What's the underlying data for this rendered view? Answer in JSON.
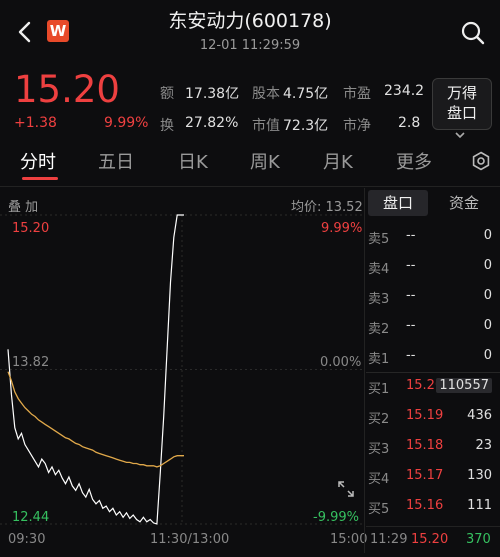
{
  "header": {
    "title": "东安动力(600178)",
    "time": "12-01 11:29:59",
    "logo_letter": "W",
    "back_icon": "chevron-left-icon",
    "search_icon": "search-icon"
  },
  "quote": {
    "price": "15.20",
    "change": "+1.38",
    "change_pct": "9.99%",
    "stats": [
      {
        "label": "额",
        "value": "17.38亿"
      },
      {
        "label": "股本",
        "value": "4.75亿"
      },
      {
        "label": "市盈",
        "value": "234.2"
      },
      {
        "label": "换",
        "value": "27.82%"
      },
      {
        "label": "市值",
        "value": "72.3亿"
      },
      {
        "label": "市净",
        "value": "2.8"
      }
    ],
    "wande_line1": "万得",
    "wande_line2": "盘口",
    "up_color": "#ee4040",
    "down_color": "#36c060"
  },
  "tabs": [
    {
      "label": "分时",
      "active": true
    },
    {
      "label": "五日",
      "active": false
    },
    {
      "label": "日K",
      "active": false
    },
    {
      "label": "周K",
      "active": false
    },
    {
      "label": "月K",
      "active": false
    },
    {
      "label": "更多",
      "active": false
    }
  ],
  "chart_labels": {
    "overlay": "叠 加",
    "avg_price": "均价: 13.52",
    "high": "15.20",
    "high_pct": "9.99%",
    "mid": "13.82",
    "mid_pct": "0.00%",
    "low": "12.44",
    "low_pct": "-9.99%",
    "t_start": "09:30",
    "t_mid": "11:30/13:00",
    "t_end": "15:00"
  },
  "chart_data": {
    "type": "line",
    "ylim": [
      12.44,
      15.2
    ],
    "series": [
      {
        "name": "price",
        "color": "#ffffff",
        "values": [
          14.0,
          13.6,
          13.3,
          13.2,
          13.25,
          13.15,
          13.1,
          13.05,
          13.0,
          12.95,
          13.02,
          12.98,
          12.9,
          12.95,
          12.88,
          12.92,
          12.85,
          12.8,
          12.86,
          12.78,
          12.74,
          12.8,
          12.72,
          12.68,
          12.75,
          12.66,
          12.62,
          12.65,
          12.58,
          12.6,
          12.55,
          12.58,
          12.52,
          12.55,
          12.5,
          12.54,
          12.49,
          12.52,
          12.48,
          12.46,
          12.5,
          12.46,
          12.48,
          12.45,
          12.44,
          12.9,
          13.4,
          14.0,
          14.6,
          15.0,
          15.2,
          15.2,
          15.2
        ]
      },
      {
        "name": "avg",
        "color": "#e0a84a",
        "values": [
          13.8,
          13.72,
          13.62,
          13.56,
          13.52,
          13.48,
          13.45,
          13.42,
          13.4,
          13.37,
          13.35,
          13.33,
          13.31,
          13.29,
          13.27,
          13.25,
          13.23,
          13.21,
          13.2,
          13.18,
          13.16,
          13.15,
          13.13,
          13.12,
          13.11,
          13.1,
          13.08,
          13.07,
          13.06,
          13.05,
          13.04,
          13.03,
          13.02,
          13.01,
          13.0,
          12.99,
          12.99,
          12.98,
          12.98,
          12.97,
          12.97,
          12.96,
          12.96,
          12.96,
          12.95,
          12.96,
          12.98,
          13.0,
          13.02,
          13.04,
          13.05,
          13.05,
          13.05
        ]
      }
    ]
  },
  "orderbook": {
    "tab_active": "盘口",
    "tab_other": "资金",
    "rows": [
      {
        "label": "卖5",
        "price": "--",
        "vol": "0",
        "type": "sell"
      },
      {
        "label": "卖4",
        "price": "--",
        "vol": "0",
        "type": "sell"
      },
      {
        "label": "卖3",
        "price": "--",
        "vol": "0",
        "type": "sell"
      },
      {
        "label": "卖2",
        "price": "--",
        "vol": "0",
        "type": "sell"
      },
      {
        "label": "卖1",
        "price": "--",
        "vol": "0",
        "type": "sell"
      },
      {
        "label": "买1",
        "price": "15.20",
        "vol": "110557",
        "type": "buy"
      },
      {
        "label": "买2",
        "price": "15.19",
        "vol": "436",
        "type": "buy"
      },
      {
        "label": "买3",
        "price": "15.18",
        "vol": "23",
        "type": "buy"
      },
      {
        "label": "买4",
        "price": "15.17",
        "vol": "130",
        "type": "buy"
      },
      {
        "label": "买5",
        "price": "15.16",
        "vol": "111",
        "type": "buy"
      }
    ],
    "last_trade": {
      "time": "11:29",
      "price": "15.20",
      "vol": "370"
    }
  }
}
